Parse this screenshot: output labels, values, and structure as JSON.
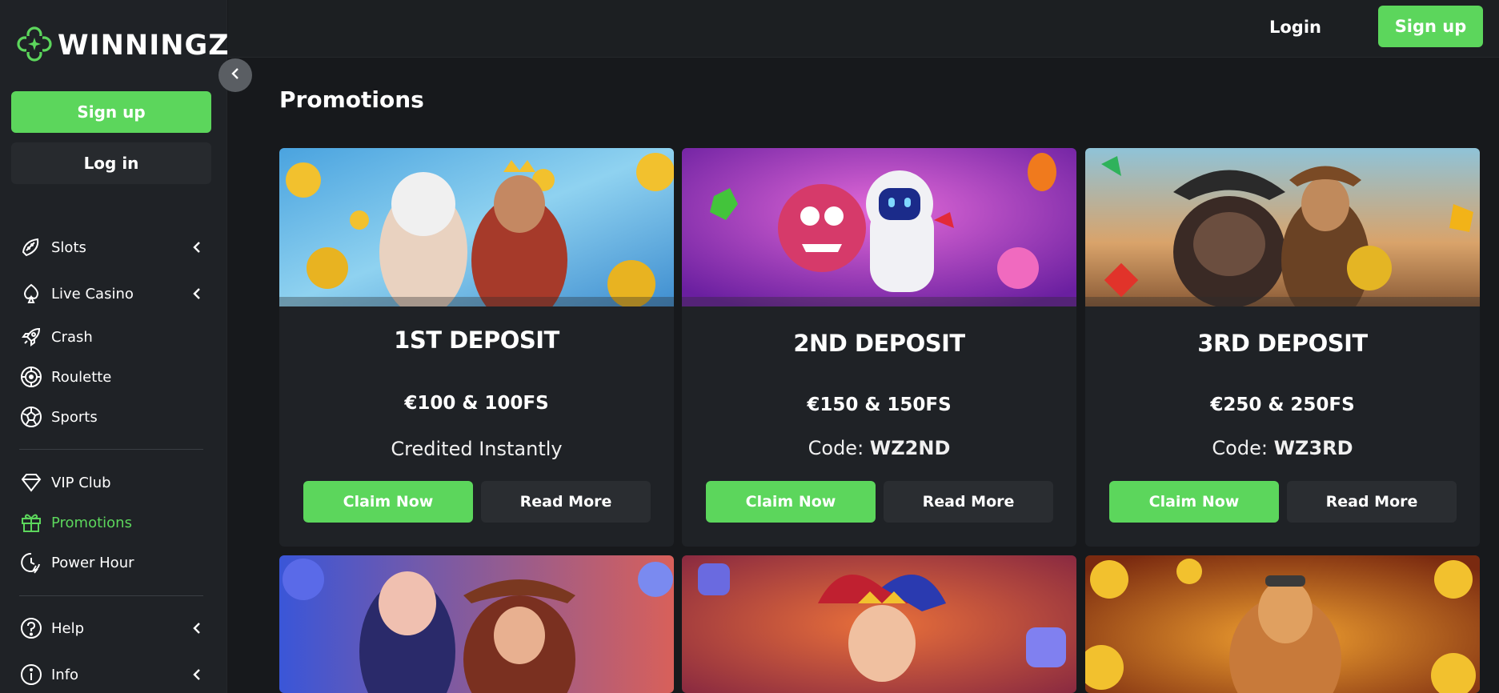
{
  "brand": {
    "name": "WINNINGZ"
  },
  "sidebar": {
    "signup_label": "Sign up",
    "login_label": "Log in",
    "nav": [
      {
        "label": "Slots",
        "icon": "slots-icon",
        "chevron": true
      },
      {
        "label": "Live Casino",
        "icon": "live-casino-icon",
        "chevron": true
      },
      {
        "label": "Crash",
        "icon": "rocket-icon",
        "chevron": false
      },
      {
        "label": "Roulette",
        "icon": "roulette-icon",
        "chevron": false
      },
      {
        "label": "Sports",
        "icon": "soccer-ball-icon",
        "chevron": false
      }
    ],
    "nav2": [
      {
        "label": "VIP Club",
        "icon": "diamond-icon"
      },
      {
        "label": "Promotions",
        "icon": "gift-icon",
        "active": true
      },
      {
        "label": "Power Hour",
        "icon": "clock-icon"
      }
    ],
    "nav3": [
      {
        "label": "Help",
        "icon": "help-icon",
        "chevron": true
      },
      {
        "label": "Info",
        "icon": "info-icon",
        "chevron": true
      }
    ]
  },
  "topbar": {
    "login_label": "Login",
    "signup_label": "Sign up"
  },
  "main": {
    "title": "Promotions",
    "cards": [
      {
        "title": "1ST DEPOSIT",
        "amount": "€100 & 100FS",
        "sub_text": "Credited Instantly",
        "code_prefix": "",
        "code": "",
        "claim_label": "Claim Now",
        "read_label": "Read More"
      },
      {
        "title": "2ND DEPOSIT",
        "amount": "€150 & 150FS",
        "sub_text": "",
        "code_prefix": "Code: ",
        "code": "WZ2ND",
        "claim_label": "Claim Now",
        "read_label": "Read More"
      },
      {
        "title": "3RD DEPOSIT",
        "amount": "€250 & 250FS",
        "sub_text": "",
        "code_prefix": "Code: ",
        "code": "WZ3RD",
        "claim_label": "Claim Now",
        "read_label": "Read More"
      }
    ]
  },
  "colors": {
    "accent": "#5cd65c",
    "bg": "#17191c",
    "panel": "#1f2226"
  }
}
